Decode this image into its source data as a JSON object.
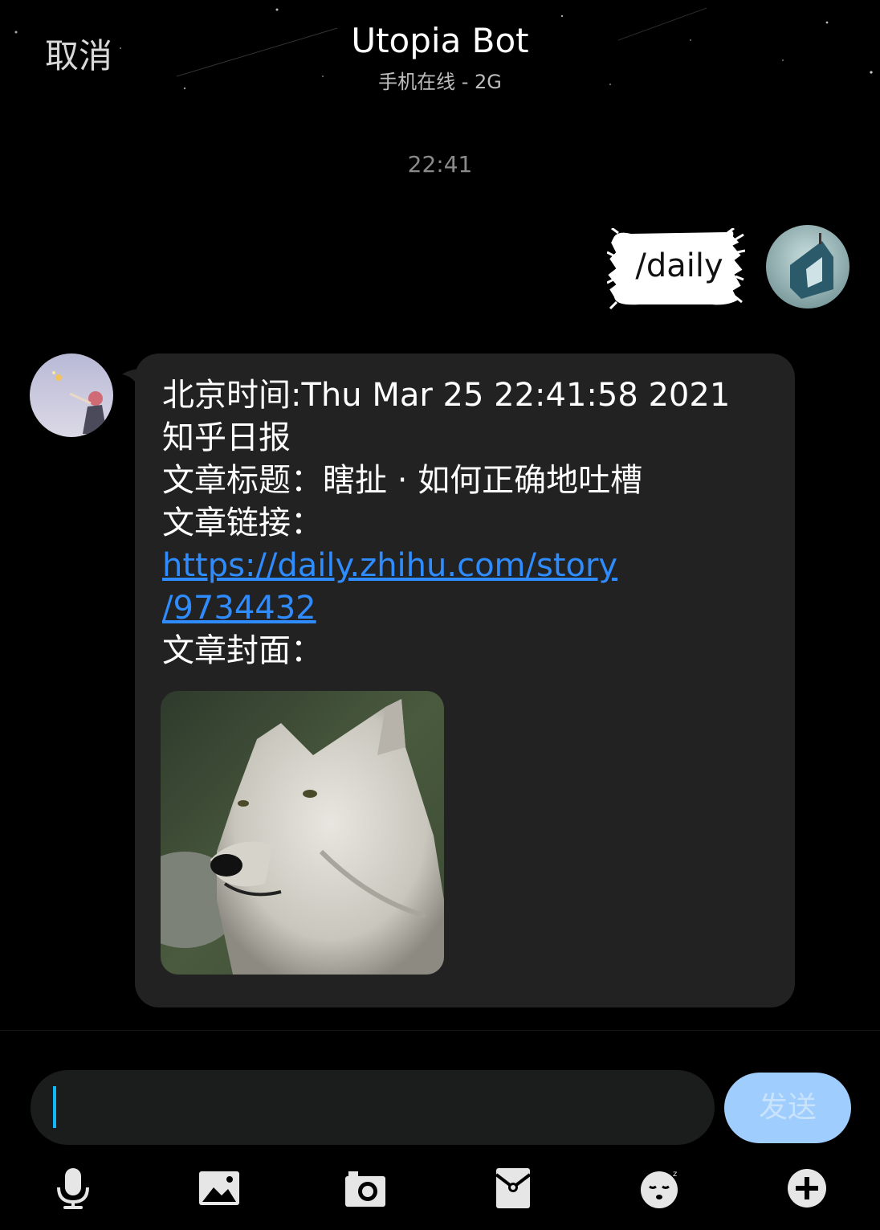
{
  "header": {
    "cancel_label": "取消",
    "title": "Utopia Bot",
    "subtitle": "手机在线 - 2G"
  },
  "conversation": {
    "timestamp": "22:41",
    "outgoing": {
      "text": "/daily"
    },
    "incoming": {
      "lines": [
        "北京时间:Thu Mar 25 22:41:58 2021",
        "知乎日报",
        "文章标题：瞎扯 · 如何正确地吐槽",
        "文章链接："
      ],
      "link_line1": "https://daily.zhihu.com/story",
      "link_line2": "/9734432",
      "cover_label": "文章封面："
    }
  },
  "composer": {
    "input_value": "",
    "send_label": "发送"
  },
  "toolbar": {
    "icons": [
      "microphone-icon",
      "image-icon",
      "camera-icon",
      "red-packet-icon",
      "emoji-icon",
      "plus-icon"
    ]
  },
  "colors": {
    "background": "#000000",
    "bubble_incoming": "#222222",
    "link": "#2f8cff",
    "send_button": "#9fcdfd",
    "caret": "#12b7f5"
  }
}
